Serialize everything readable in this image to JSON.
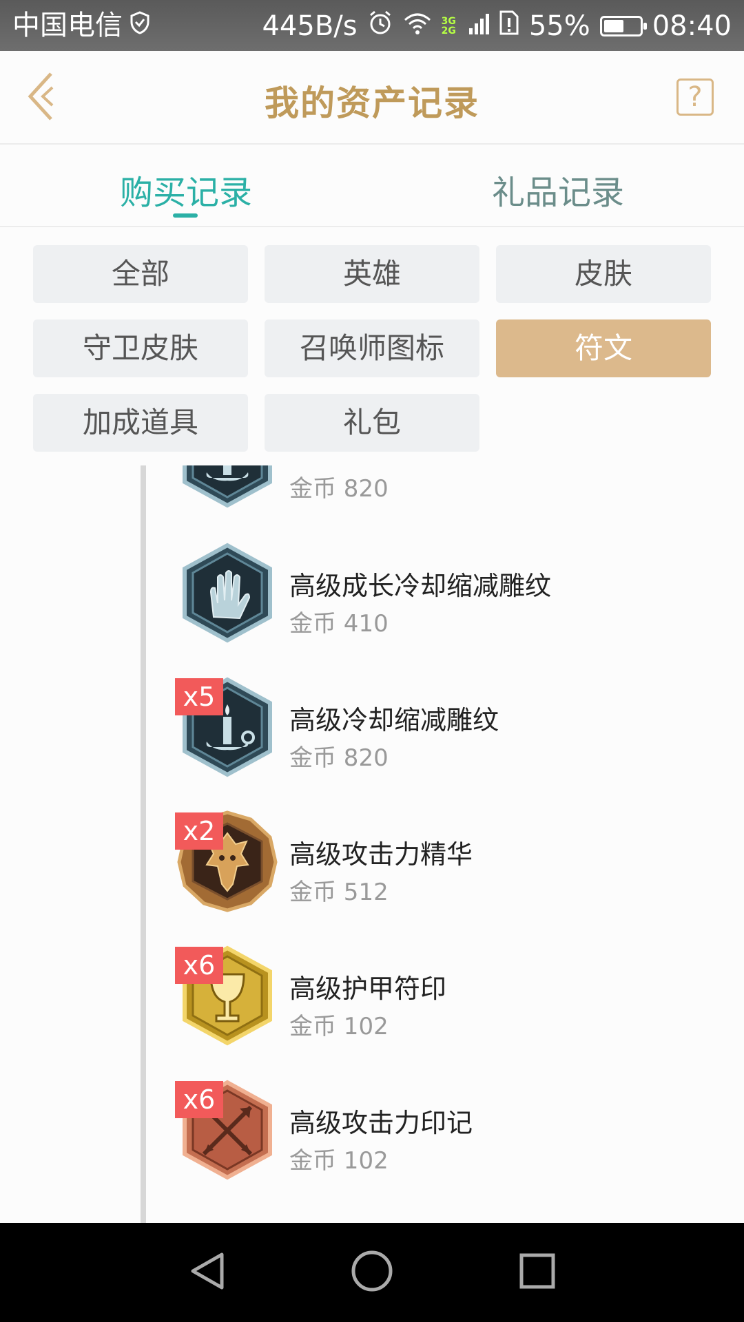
{
  "status_bar": {
    "carrier": "中国电信",
    "speed": "445B/s",
    "network_top": "3G",
    "network_bottom": "2G",
    "battery_percent": "55%",
    "battery_level": 0.55,
    "time": "08:40"
  },
  "header": {
    "title": "我的资产记录",
    "help_label": "?"
  },
  "tabs": [
    {
      "label": "购买记录",
      "active": true
    },
    {
      "label": "礼品记录",
      "active": false
    }
  ],
  "filters": [
    {
      "label": "全部",
      "active": false
    },
    {
      "label": "英雄",
      "active": false
    },
    {
      "label": "皮肤",
      "active": false
    },
    {
      "label": "守卫皮肤",
      "active": false
    },
    {
      "label": "召唤师图标",
      "active": false
    },
    {
      "label": "符文",
      "active": true
    },
    {
      "label": "加成道具",
      "active": false
    },
    {
      "label": "礼包",
      "active": false
    }
  ],
  "items": [
    {
      "name": "",
      "price": "金币 820",
      "badge": "",
      "icon": "candle-rune-icon"
    },
    {
      "name": "高级成长冷却缩减雕纹",
      "price": "金币 410",
      "badge": "",
      "icon": "hand-rune-icon"
    },
    {
      "name": "高级冷却缩减雕纹",
      "price": "金币 820",
      "badge": "x5",
      "icon": "candle-rune-icon"
    },
    {
      "name": "高级攻击力精华",
      "price": "金币 512",
      "badge": "x2",
      "icon": "dragon-rune-icon"
    },
    {
      "name": "高级护甲符印",
      "price": "金币 102",
      "badge": "x6",
      "icon": "chalice-rune-icon"
    },
    {
      "name": "高级攻击力印记",
      "price": "金币 102",
      "badge": "x6",
      "icon": "crossed-arrows-rune-icon"
    }
  ],
  "colors": {
    "accent_gold": "#bf9a5a",
    "tab_active": "#2bb0a6",
    "chip_active": "#dcb98c",
    "badge": "#f25a5a"
  }
}
